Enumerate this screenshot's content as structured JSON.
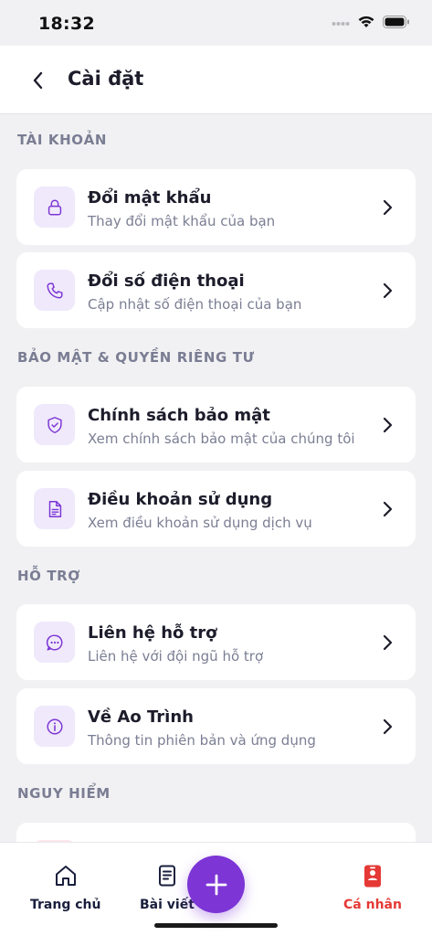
{
  "status": {
    "time": "18:32"
  },
  "header": {
    "title": "Cài đặt"
  },
  "sections": [
    {
      "title": "TÀI KHOẢN",
      "items": [
        {
          "title": "Đổi mật khẩu",
          "subtitle": "Thay đổi mật khẩu của bạn",
          "icon": "lock-icon"
        },
        {
          "title": "Đổi số điện thoại",
          "subtitle": "Cập nhật số điện thoại của bạn",
          "icon": "phone-icon"
        }
      ]
    },
    {
      "title": "BẢO MẬT & QUYỀN RIÊNG TƯ",
      "items": [
        {
          "title": "Chính sách bảo mật",
          "subtitle": "Xem chính sách bảo mật của chúng tôi",
          "icon": "shield-check-icon"
        },
        {
          "title": "Điều khoản sử dụng",
          "subtitle": "Xem điều khoản sử dụng dịch vụ",
          "icon": "document-icon"
        }
      ]
    },
    {
      "title": "HỖ TRỢ",
      "items": [
        {
          "title": "Liên hệ hỗ trợ",
          "subtitle": "Liên hệ với đội ngũ hỗ trợ",
          "icon": "chat-bubble-icon"
        },
        {
          "title": "Về Ao Trình",
          "subtitle": "Thông tin phiên bản và ứng dụng",
          "icon": "info-icon"
        }
      ]
    },
    {
      "title": "NGUY HIỂM",
      "items": []
    }
  ],
  "tabbar": {
    "home": "Trang chủ",
    "posts": "Bài viết",
    "profile": "Cá nhân",
    "fab_icon": "plus-icon"
  },
  "colors": {
    "accent": "#7d35d6",
    "icon_bg": "#efe9fb",
    "active_tab": "#e53935",
    "section_title": "#7a7d93"
  }
}
